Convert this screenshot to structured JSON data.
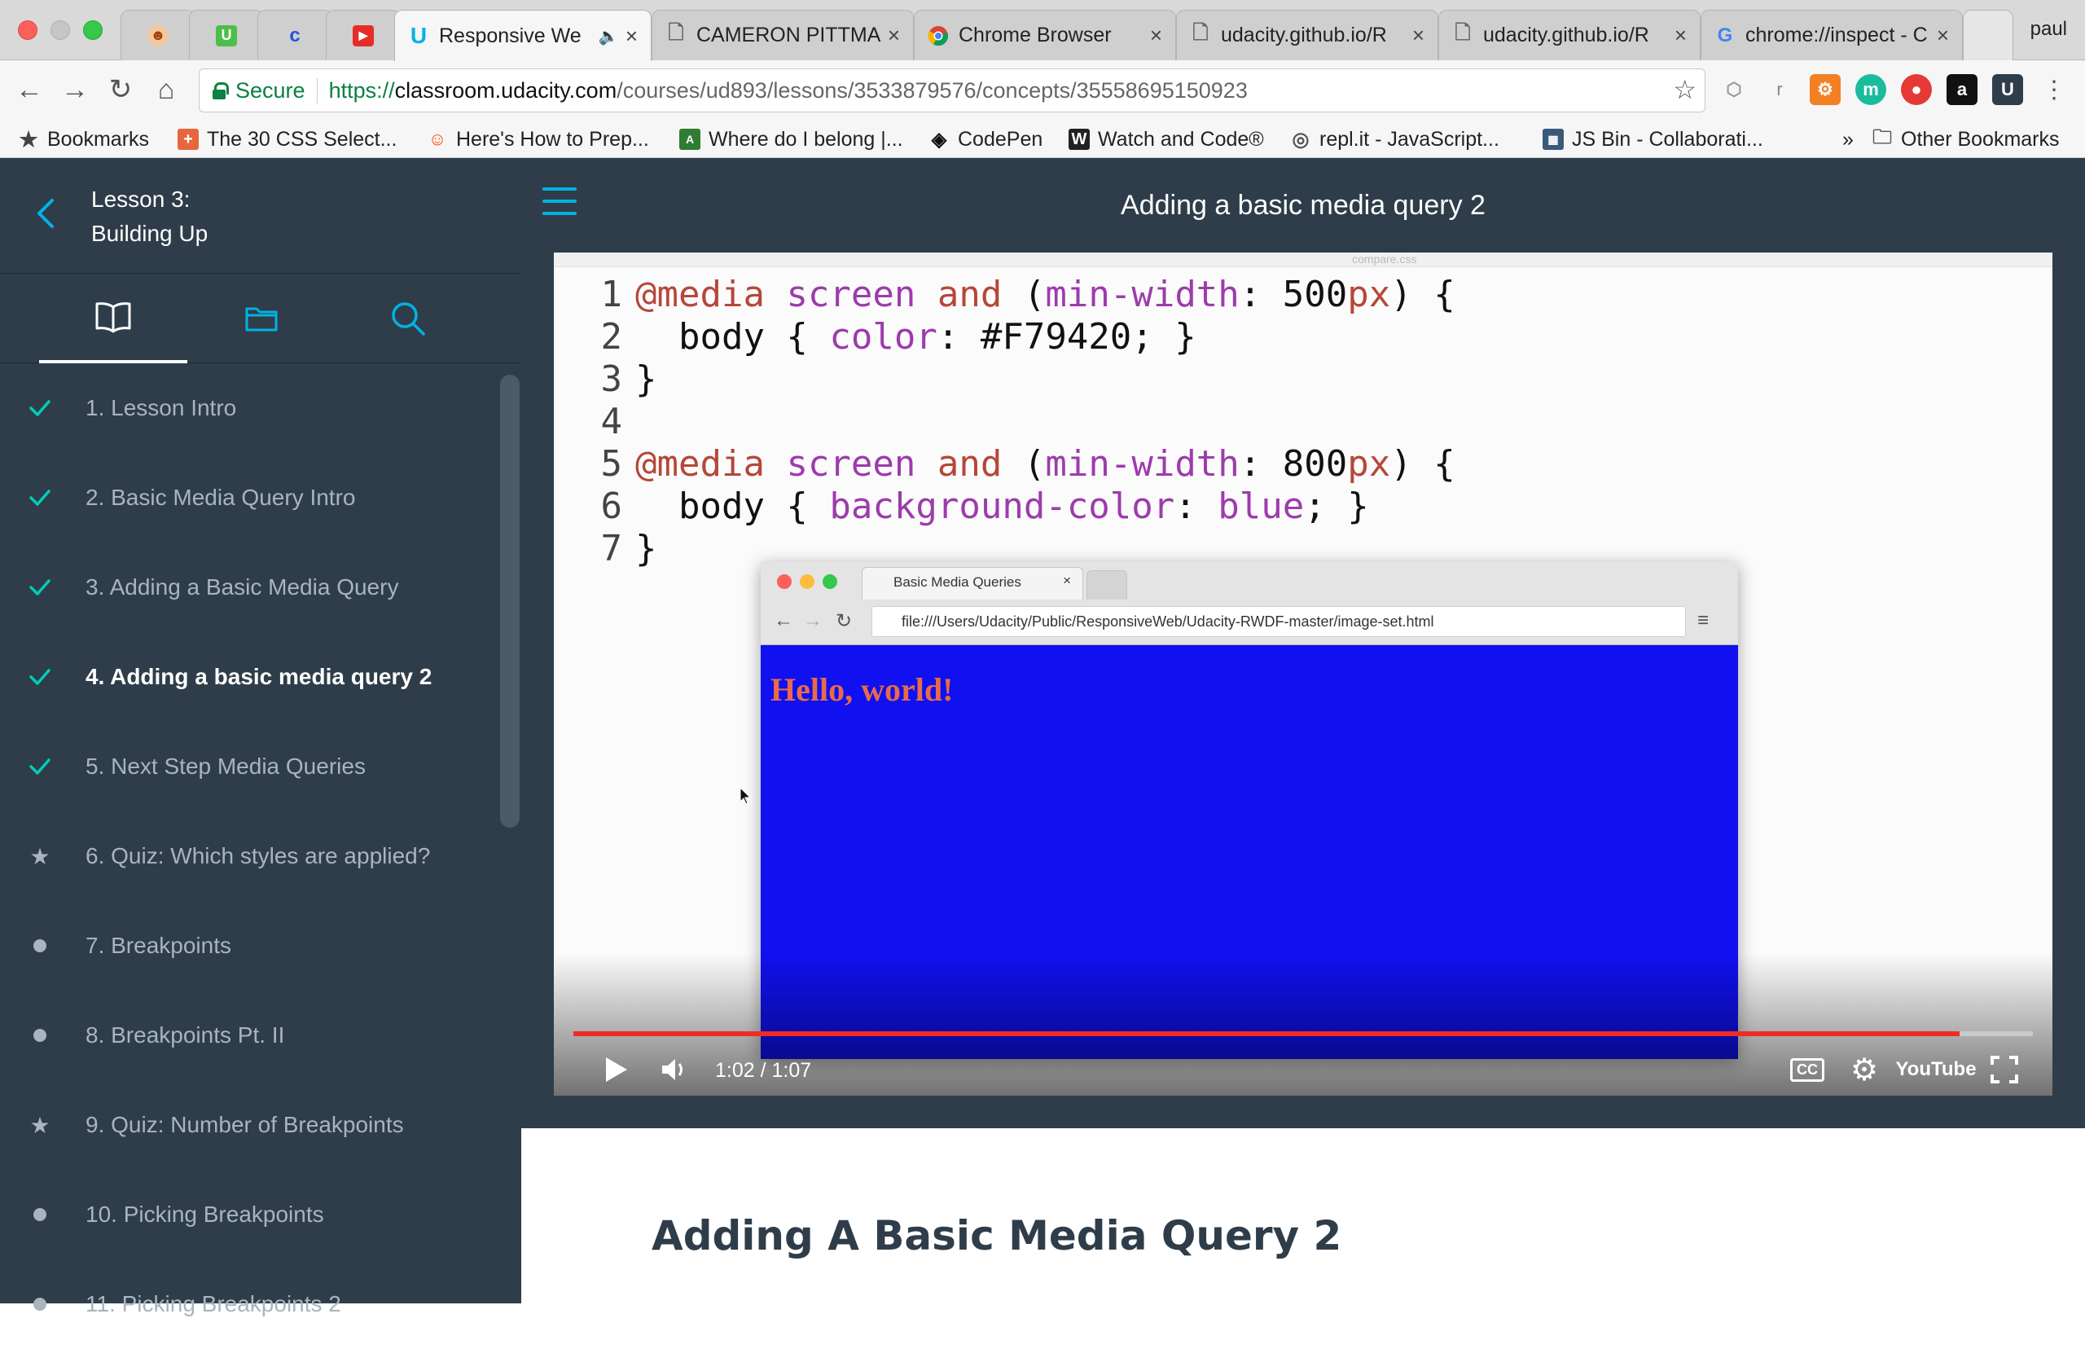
{
  "browser": {
    "tabs": [
      {
        "label": "",
        "icon": "monkey-icon"
      },
      {
        "label": "",
        "icon": "udemy-icon"
      },
      {
        "label": "",
        "icon": "c-icon"
      },
      {
        "label": "",
        "icon": "youtube-icon"
      },
      {
        "label": "Responsive We",
        "icon": "udacity-icon",
        "active": true,
        "audio": true
      },
      {
        "label": "CAMERON PITTMA",
        "icon": "document-icon"
      },
      {
        "label": "Chrome Browser",
        "icon": "chrome-icon"
      },
      {
        "label": "udacity.github.io/R",
        "icon": "document-icon"
      },
      {
        "label": "udacity.github.io/R",
        "icon": "document-icon"
      },
      {
        "label": "chrome://inspect - C",
        "icon": "google-icon"
      }
    ],
    "profile_name": "paul",
    "secure_label": "Secure",
    "url": {
      "scheme": "https://",
      "host": "classroom.udacity.com",
      "path": "/courses/ud893/lessons/3533879576/concepts/35558695150923"
    },
    "extensions": [
      "cube-ext",
      "r-ext",
      "hubspot-ext",
      "m-ext",
      "tomato-ext",
      "amazon-ext",
      "udacity-ext"
    ],
    "bookmarks": [
      {
        "label": "Bookmarks",
        "icon": "star-icon"
      },
      {
        "label": "The 30 CSS Select...",
        "icon": "plus-icon"
      },
      {
        "label": "Here's How to Prep...",
        "icon": "reddit-icon"
      },
      {
        "label": "Where do I belong |...",
        "icon": "html-icon"
      },
      {
        "label": "CodePen",
        "icon": "codepen-icon"
      },
      {
        "label": "Watch and Code®",
        "icon": "w-icon"
      },
      {
        "label": "repl.it - JavaScript...",
        "icon": "replit-icon"
      },
      {
        "label": "JS Bin - Collaborati...",
        "icon": "jsbin-icon"
      }
    ],
    "bookmarks_overflow": "»",
    "other_bookmarks": "Other Bookmarks"
  },
  "sidebar": {
    "lesson_number": "Lesson 3:",
    "lesson_name": "Building Up",
    "items": [
      {
        "label": "1. Lesson Intro",
        "state": "done"
      },
      {
        "label": "2. Basic Media Query Intro",
        "state": "done"
      },
      {
        "label": "3. Adding a Basic Media Query",
        "state": "done"
      },
      {
        "label": "4. Adding a basic media query 2",
        "state": "current"
      },
      {
        "label": "5. Next Step Media Queries",
        "state": "done"
      },
      {
        "label": "6. Quiz: Which styles are applied?",
        "state": "quiz"
      },
      {
        "label": "7. Breakpoints",
        "state": "todo"
      },
      {
        "label": "8. Breakpoints Pt. II",
        "state": "todo"
      },
      {
        "label": "9. Quiz: Number of Breakpoints",
        "state": "quiz"
      },
      {
        "label": "10. Picking Breakpoints",
        "state": "todo"
      },
      {
        "label": "11. Picking Breakpoints 2",
        "state": "todo"
      }
    ]
  },
  "header": {
    "title": "Adding a basic media query 2"
  },
  "video": {
    "code_lines": [
      {
        "n": "1",
        "html": "<span class='kw'>@media</span> <span class='pr'>screen</span> <span class='kw'>and</span> (<span class='pr'>min-width</span>: 500<span class='px'>px</span>) {"
      },
      {
        "n": "2",
        "html": "  body { <span class='pr'>color</span>: #F79420; }"
      },
      {
        "n": "3",
        "html": "}"
      },
      {
        "n": "4",
        "html": ""
      },
      {
        "n": "5",
        "html": "<span class='kw'>@media</span> <span class='pr'>screen</span> <span class='kw'>and</span> (<span class='pr'>min-width</span>: 800<span class='px'>px</span>) {"
      },
      {
        "n": "6",
        "html": "  body { <span class='pr'>background-color</span>: <span class='pr'>blue</span>; }"
      },
      {
        "n": "7",
        "html": "}"
      }
    ],
    "editor_filename": "compare.css",
    "inner_tab_label": "Basic Media Queries",
    "inner_url": "file:///Users/Udacity/Public/ResponsiveWeb/Udacity-RWDF-master/image-set.html",
    "inner_heading": "Hello, world!",
    "time": "1:02 / 1:07",
    "progress": 0.95,
    "youtube_label": "YouTube",
    "cc_label": "CC"
  },
  "content": {
    "title": "Adding A Basic Media Query 2"
  }
}
